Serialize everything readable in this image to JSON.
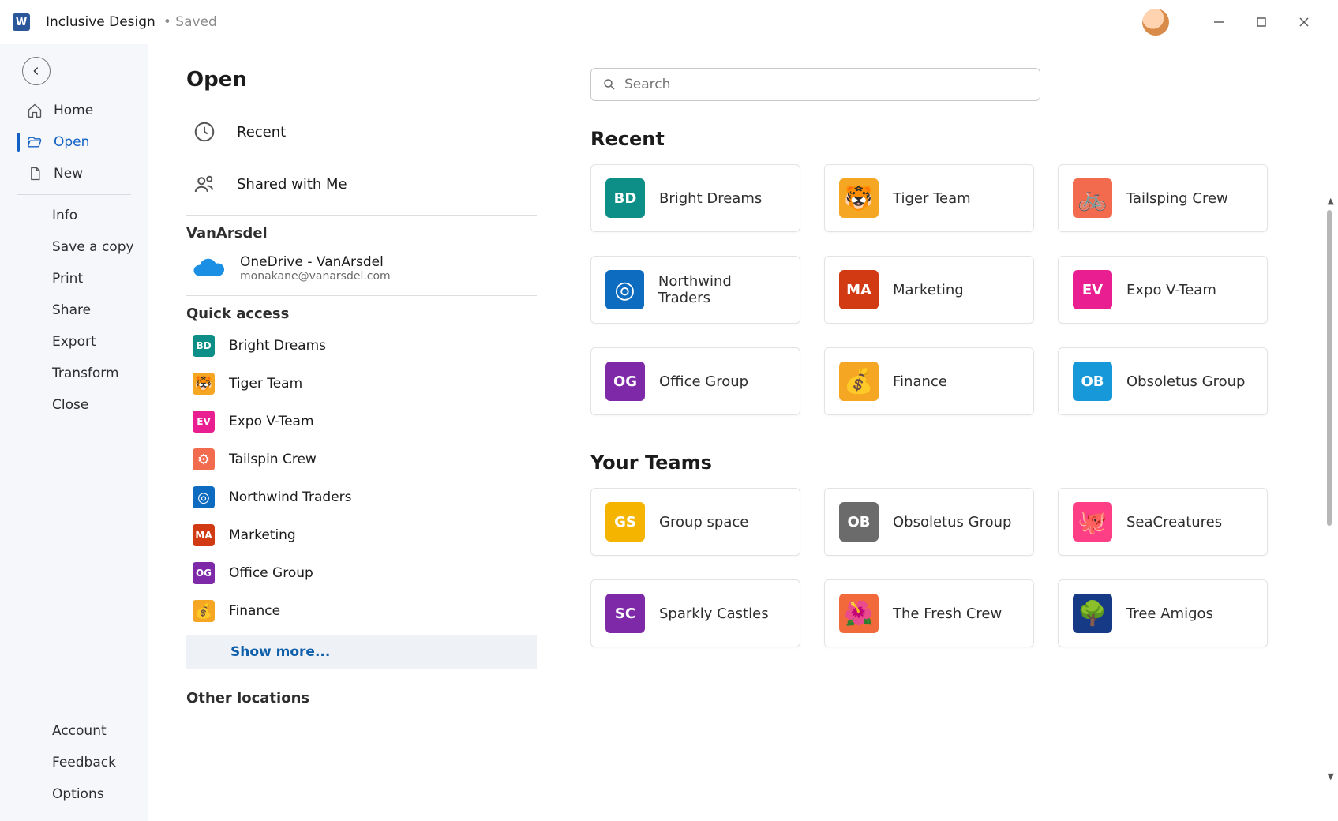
{
  "titlebar": {
    "doc_title": "Inclusive Design",
    "saved_label": "• Saved"
  },
  "leftnav": {
    "home": "Home",
    "open": "Open",
    "new": "New",
    "info": "Info",
    "save_copy": "Save a copy",
    "print": "Print",
    "share": "Share",
    "export": "Export",
    "transform": "Transform",
    "close": "Close",
    "account": "Account",
    "feedback": "Feedback",
    "options": "Options"
  },
  "middle": {
    "heading": "Open",
    "recent": "Recent",
    "shared": "Shared with Me",
    "account_section": "VanArsdel",
    "onedrive_title": "OneDrive - VanArsdel",
    "onedrive_sub": "monakane@vanarsdel.com",
    "quick_access_label": "Quick access",
    "quick_access": [
      {
        "label": "Bright Dreams",
        "initials": "BD",
        "color": "c-teal"
      },
      {
        "label": "Tiger Team",
        "initials": "🐯",
        "color": "c-amber",
        "emoji": true
      },
      {
        "label": "Expo V-Team",
        "initials": "EV",
        "color": "c-pink"
      },
      {
        "label": "Tailspin Crew",
        "initials": "⚙",
        "color": "c-redsoft",
        "emoji": true
      },
      {
        "label": "Northwind Traders",
        "initials": "◎",
        "color": "c-blue",
        "emoji": true
      },
      {
        "label": "Marketing",
        "initials": "MA",
        "color": "c-red"
      },
      {
        "label": "Office Group",
        "initials": "OG",
        "color": "c-purple"
      },
      {
        "label": "Finance",
        "initials": "💰",
        "color": "c-amber",
        "emoji": true
      }
    ],
    "show_more": "Show more...",
    "other_locations": "Other locations"
  },
  "rightcol": {
    "search_placeholder": "Search",
    "recent_heading": "Recent",
    "recent_cards": [
      {
        "label": "Bright Dreams",
        "initials": "BD",
        "color": "c-teal"
      },
      {
        "label": "Tiger Team",
        "initials": "🐯",
        "color": "c-amber",
        "emoji": true
      },
      {
        "label": "Tailsping Crew",
        "initials": "🚲",
        "color": "c-redsoft",
        "emoji": true
      },
      {
        "label": "Northwind Traders",
        "initials": "◎",
        "color": "c-blue",
        "emoji": true
      },
      {
        "label": "Marketing",
        "initials": "MA",
        "color": "c-red"
      },
      {
        "label": "Expo V-Team",
        "initials": "EV",
        "color": "c-pink"
      },
      {
        "label": "Office Group",
        "initials": "OG",
        "color": "c-purple"
      },
      {
        "label": "Finance",
        "initials": "💰",
        "color": "c-amber",
        "emoji": true
      },
      {
        "label": "Obsoletus Group",
        "initials": "OB",
        "color": "c-lightblue"
      }
    ],
    "teams_heading": "Your Teams",
    "teams_cards": [
      {
        "label": "Group space",
        "initials": "GS",
        "color": "c-gold"
      },
      {
        "label": "Obsoletus Group",
        "initials": "OB",
        "color": "c-grey"
      },
      {
        "label": "SeaCreatures",
        "initials": "🐙",
        "color": "c-hotpink",
        "emoji": true
      },
      {
        "label": "Sparkly Castles",
        "initials": "SC",
        "color": "c-purple"
      },
      {
        "label": "The Fresh Crew",
        "initials": "🌺",
        "color": "c-oranger",
        "emoji": true
      },
      {
        "label": "Tree Amigos",
        "initials": "🌳",
        "color": "c-navy",
        "emoji": true
      }
    ]
  }
}
